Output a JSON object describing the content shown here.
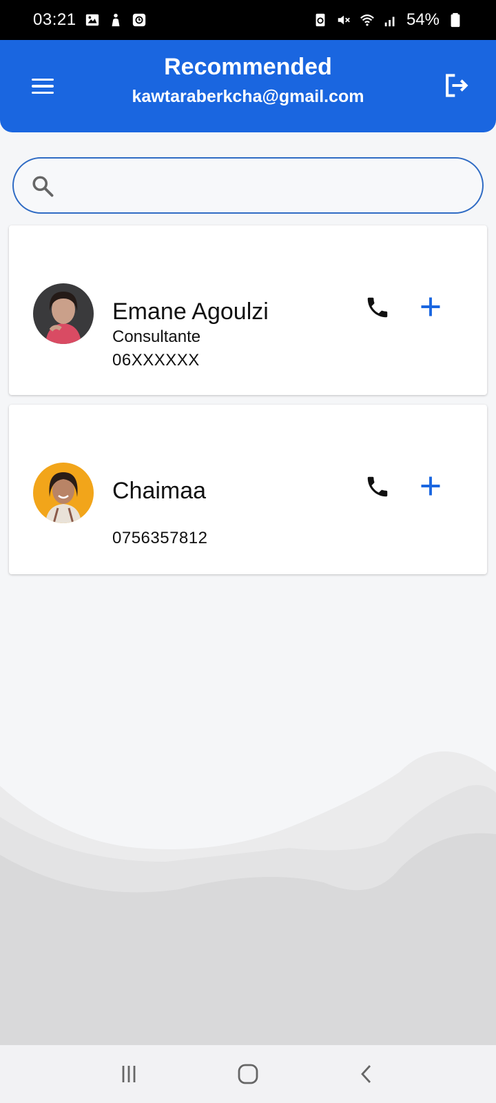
{
  "status_bar": {
    "time": "03:21",
    "battery": "54%",
    "left_icons": [
      "image-icon",
      "person-icon",
      "clock-app-icon"
    ],
    "right_icons": [
      "recycle-icon",
      "mute-icon",
      "wifi-icon",
      "signal-icon",
      "battery-icon"
    ]
  },
  "app_bar": {
    "title": "Recommended",
    "subtitle": "kawtaraberkcha@gmail.com",
    "color": "#1a66e0"
  },
  "search": {
    "value": "",
    "placeholder": ""
  },
  "contacts": [
    {
      "name": "Emane Agoulzi",
      "role": "Consultante",
      "phone": "06XXXXXX"
    },
    {
      "name": "Chaimaa",
      "role": "",
      "phone": "0756357812"
    }
  ],
  "colors": {
    "accent": "#1a66e0",
    "background": "#f5f6f8"
  }
}
